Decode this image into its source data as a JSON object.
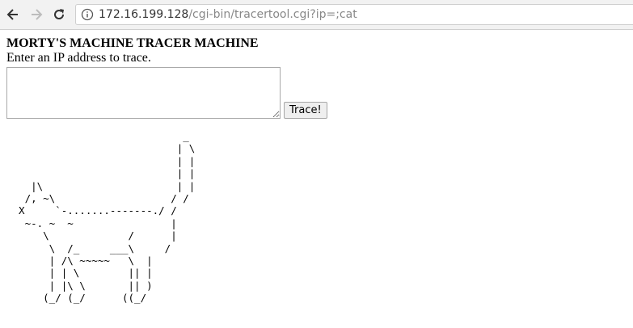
{
  "browser": {
    "url_host": "172.16.199.128",
    "url_path": "/cgi-bin/tracertool.cgi?ip=;cat"
  },
  "page": {
    "title": "MORTY'S MACHINE TRACER MACHINE",
    "prompt": "Enter an IP address to trace.",
    "input_value": "",
    "button_label": "Trace!",
    "ascii_art": "                             _\n                            | \\\n                            | |\n                            | |\n    |\\                      | |\n   /, ~\\                   / /\n  X     `-.......-------./ /\n   ~-. ~  ~                |\n      \\             /      |\n       \\  /_     ___\\     /\n       | /\\ ~~~~~   \\  |\n       | | \\        || |\n       | |\\ \\       || )\n      (_/ (_/      ((_/"
  }
}
